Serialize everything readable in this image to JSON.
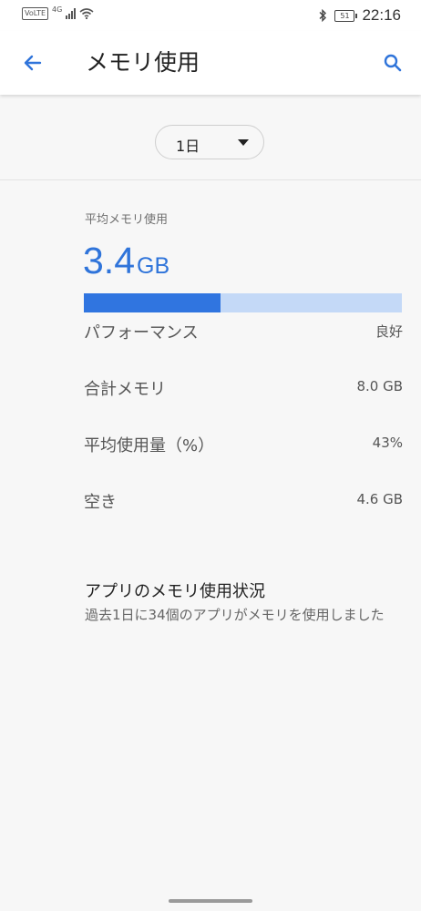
{
  "status_bar": {
    "volte": "VoLTE",
    "network": "4G",
    "time": "22:16",
    "battery_level": "51",
    "icons": [
      "signal-icon",
      "wifi-icon",
      "bluetooth-icon",
      "battery-icon"
    ]
  },
  "app_bar": {
    "title": "メモリ使用",
    "back_icon": "arrow-left-icon",
    "search_icon": "search-icon"
  },
  "period": {
    "selected": "1日",
    "icon": "caret-down-icon"
  },
  "average": {
    "label": "平均メモリ使用",
    "value": "3.4",
    "unit": "GB",
    "usage_fraction": 0.43
  },
  "stats": [
    {
      "label": "パフォーマンス",
      "value": "良好"
    },
    {
      "label": "合計メモリ",
      "value": "8.0 GB"
    },
    {
      "label": "平均使用量（%）",
      "value": "43%"
    },
    {
      "label": "空き",
      "value": "4.6 GB"
    }
  ],
  "apps_section": {
    "title": "アプリのメモリ使用状況",
    "description": "過去1日に34個のアプリがメモリを使用しました"
  },
  "colors": {
    "accent": "#3075e0",
    "accent_light": "#c4d9f7",
    "background": "#f7f7f7"
  }
}
